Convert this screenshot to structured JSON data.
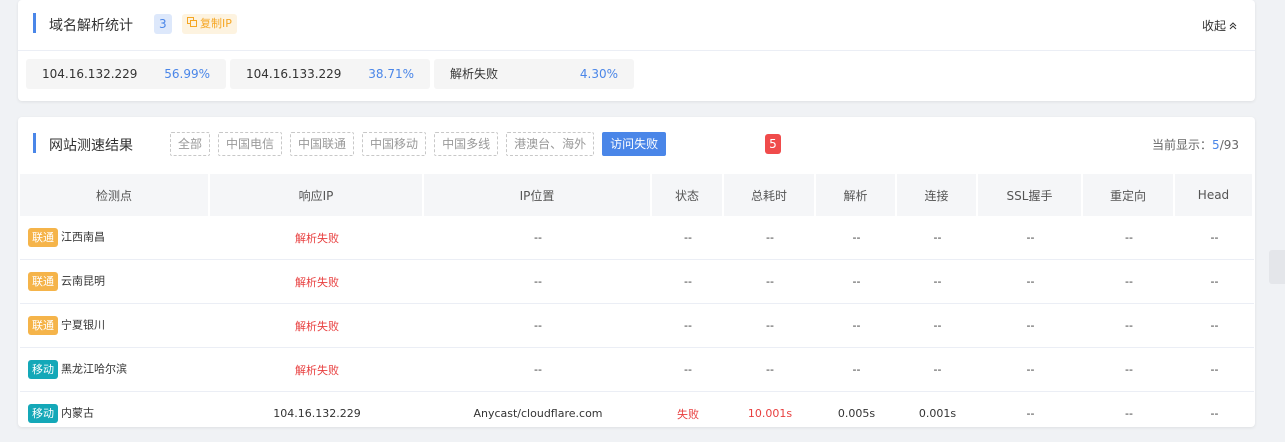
{
  "dns_section": {
    "title": "域名解析统计",
    "count": "3",
    "copy_label": "复制IP",
    "collapse_label": "收起",
    "results": [
      {
        "ip": "104.16.132.229",
        "percent": "56.99%"
      },
      {
        "ip": "104.16.133.229",
        "percent": "38.71%"
      },
      {
        "ip": "解析失败",
        "percent": "4.30%"
      }
    ]
  },
  "speed_section": {
    "title": "网站测速结果",
    "tabs": [
      "全部",
      "中国电信",
      "中国联通",
      "中国移动",
      "中国多线",
      "港澳台、海外",
      "访问失败"
    ],
    "active_tab": "访问失败",
    "fail_count": "5",
    "showing_prefix": "当前显示：",
    "showing_current": "5",
    "showing_total": "/93",
    "columns": [
      "检测点",
      "响应IP",
      "IP位置",
      "状态",
      "总耗时",
      "解析",
      "连接",
      "SSL握手",
      "重定向",
      "Head"
    ],
    "rows": [
      {
        "isp": "联通",
        "isp_type": "lt",
        "location": "江西南昌",
        "ip": "解析失败",
        "ip_loc": "--",
        "status": "--",
        "total": "--",
        "dns": "--",
        "connect": "--",
        "ssl": "--",
        "redirect": "--",
        "head": "--"
      },
      {
        "isp": "联通",
        "isp_type": "lt",
        "location": "云南昆明",
        "ip": "解析失败",
        "ip_loc": "--",
        "status": "--",
        "total": "--",
        "dns": "--",
        "connect": "--",
        "ssl": "--",
        "redirect": "--",
        "head": "--"
      },
      {
        "isp": "联通",
        "isp_type": "lt",
        "location": "宁夏银川",
        "ip": "解析失败",
        "ip_loc": "--",
        "status": "--",
        "total": "--",
        "dns": "--",
        "connect": "--",
        "ssl": "--",
        "redirect": "--",
        "head": "--"
      },
      {
        "isp": "移动",
        "isp_type": "yd",
        "location": "黑龙江哈尔滨",
        "ip": "解析失败",
        "ip_loc": "--",
        "status": "--",
        "total": "--",
        "dns": "--",
        "connect": "--",
        "ssl": "--",
        "redirect": "--",
        "head": "--"
      },
      {
        "isp": "移动",
        "isp_type": "yd",
        "location": "内蒙古",
        "ip": "104.16.132.229",
        "ip_loc": "Anycast/cloudflare.com",
        "status": "失败",
        "total": "10.001s",
        "dns": "0.005s",
        "connect": "0.001s",
        "ssl": "--",
        "redirect": "--",
        "head": "--"
      }
    ]
  },
  "colors": {
    "accent": "#4a86e8",
    "error": "#e83e3e",
    "unicom": "#f5b44a",
    "mobile": "#14a8b8"
  }
}
